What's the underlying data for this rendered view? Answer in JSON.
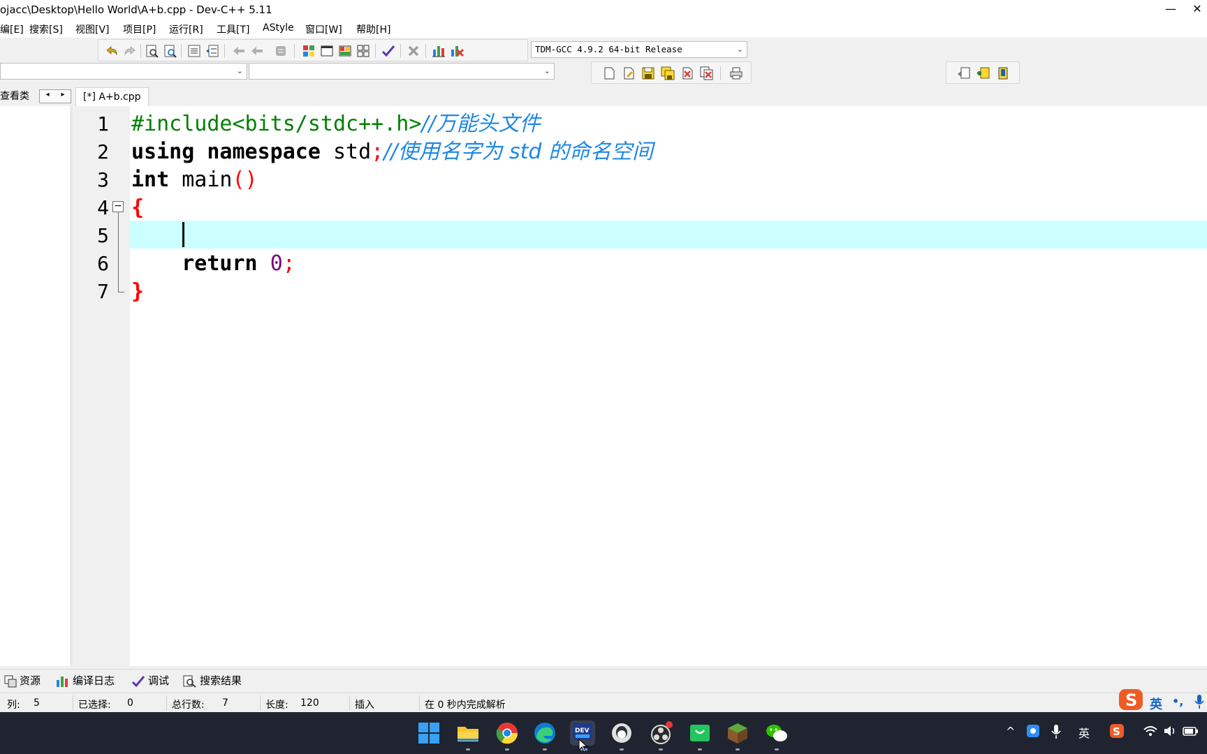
{
  "window": {
    "title": "ojacc\\Desktop\\Hello World\\A+b.cpp - Dev-C++ 5.11",
    "minimize_glyph": "—",
    "close_glyph": "✕"
  },
  "menu": {
    "edit": "编[E]",
    "search": "搜索[S]",
    "view": "视图[V]",
    "project": "项目[P]",
    "run": "运行[R]",
    "tools": "工具[T]",
    "astyle": "AStyle",
    "window": "窗口[W]",
    "help": "帮助[H]"
  },
  "toolbar": {
    "compiler_select": "TDM-GCC 4.9.2 64-bit Release",
    "class_combo_value": "",
    "member_combo_value": ""
  },
  "tabs": {
    "class_browser": "查看类",
    "scroll_left": "◂",
    "scroll_right": "▸",
    "file_tab": "[*] A+b.cpp"
  },
  "editor": {
    "line_numbers": [
      "1",
      "2",
      "3",
      "4",
      "5",
      "6",
      "7"
    ],
    "fold_collapse_glyph": "−",
    "code": {
      "l1_directive": "#include<bits/stdc++.h>",
      "l1_comment": "//万能头文件",
      "l2_kw1": "using",
      "l2_kw2": "namespace",
      "l2_ident": "std",
      "l2_semi": ";",
      "l2_comment": "//使用名字为 std 的命名空间",
      "l3_kw": "int",
      "l3_ident": "main",
      "l3_parens": "()",
      "l4_brace": "{",
      "l6_kw": "return",
      "l6_num": "0",
      "l6_semi": ";",
      "l7_brace": "}"
    }
  },
  "bottom_tabs": {
    "resources": "资源",
    "compile_log": "编译日志",
    "debug": "调试",
    "search_results": "搜索结果"
  },
  "status": {
    "col_label": "列:",
    "col_value": "5",
    "selected_label": "已选择:",
    "selected_value": "0",
    "lines_label": "总行数:",
    "lines_value": "7",
    "length_label": "长度:",
    "length_value": "120",
    "mode": "插入",
    "parse_msg": "在 0 秒内完成解析"
  },
  "ime": {
    "lang": "英",
    "punct": "•,"
  },
  "tray": {
    "lang": "英",
    "up_arrow": "^"
  },
  "colors": {
    "current_line": "#ccffff",
    "preprocessor": "#008000",
    "comment": "#1e88e5",
    "brace": "#ff0000",
    "number": "#800080"
  }
}
